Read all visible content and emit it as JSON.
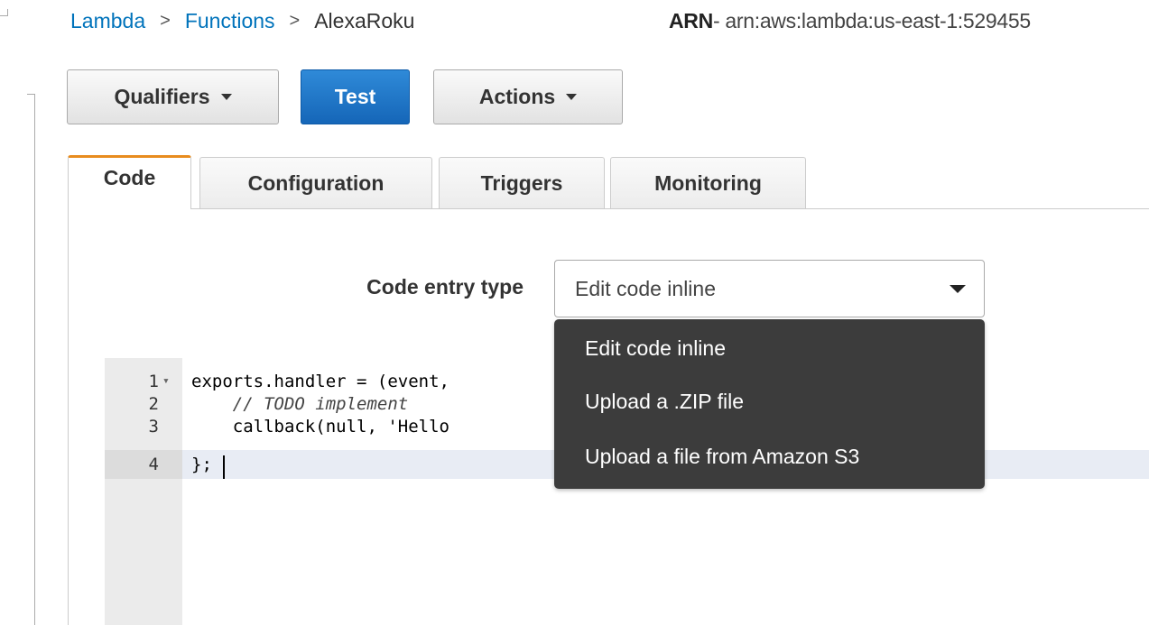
{
  "breadcrumb": {
    "root": "Lambda",
    "section": "Functions",
    "current": "AlexaRoku",
    "separator": ">"
  },
  "arn": {
    "label": "ARN",
    "value": " - arn:aws:lambda:us-east-1:529455"
  },
  "toolbar": {
    "qualifiers_label": "Qualifiers",
    "test_label": "Test",
    "actions_label": "Actions"
  },
  "tabs": [
    {
      "label": "Code",
      "active": true
    },
    {
      "label": "Configuration",
      "active": false
    },
    {
      "label": "Triggers",
      "active": false
    },
    {
      "label": "Monitoring",
      "active": false
    }
  ],
  "code_entry": {
    "label": "Code entry type",
    "selected": "Edit code inline",
    "options": [
      "Edit code inline",
      "Upload a .ZIP file",
      "Upload a file from Amazon S3"
    ]
  },
  "editor": {
    "line_numbers": [
      "1",
      "2",
      "3",
      "4"
    ],
    "lines": [
      "exports.handler = (event,",
      "    // TODO implement",
      "    callback(null, 'Hello",
      "};"
    ]
  },
  "colors": {
    "link": "#0073bb",
    "primary_button": "#1566b8",
    "active_tab_accent": "#e88c1e",
    "menu_background": "#3c3c3c"
  }
}
